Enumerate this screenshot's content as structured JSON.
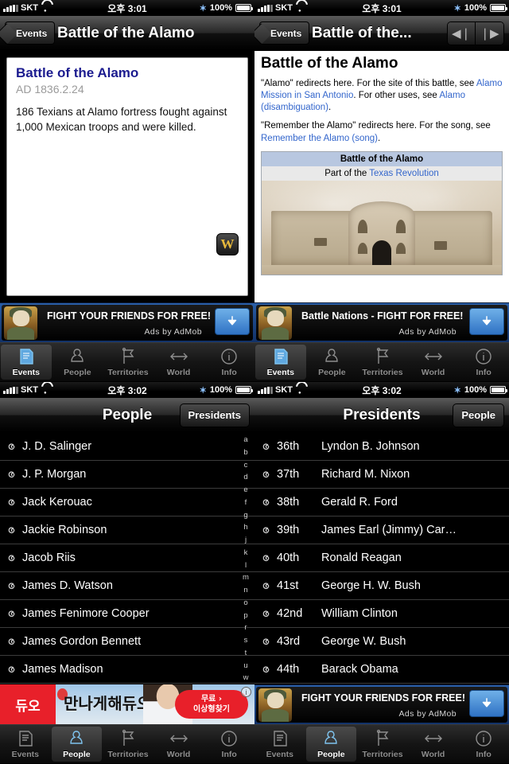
{
  "statusbar": {
    "carrier": "SKT",
    "time_top": "오후 3:01",
    "time_bottom": "오후 3:02",
    "battery": "100%",
    "wifi_icon": "wifi-icon",
    "bluetooth_icon": "bluetooth-icon",
    "signal_icon": "signal-bars-icon"
  },
  "panel_top_left": {
    "nav": {
      "back_label": "Events",
      "title": "Battle of the Alamo"
    },
    "card": {
      "title": "Battle of the Alamo",
      "date": "AD 1836.2.24",
      "body": "186 Texians at Alamo fortress fought against 1,000 Mexican troops and were killed.",
      "wiki_badge": "W"
    },
    "ad": {
      "title": "FIGHT YOUR FRIENDS FOR FREE!",
      "attribution": "Ads by AdMob",
      "download_icon": "download-arrow-icon"
    }
  },
  "panel_top_right": {
    "nav": {
      "back_label": "Events",
      "title": "Battle of the...",
      "prev_icon": "prev-arrow-icon",
      "next_icon": "next-arrow-icon"
    },
    "wiki": {
      "heading": "Battle of the Alamo",
      "para1_a": "\"Alamo\" redirects here. For the site of this battle, see ",
      "para1_link1": "Alamo Mission in San Antonio",
      "para1_b": ". For other uses, see ",
      "para1_link2": "Alamo (disambiguation)",
      "para1_c": ".",
      "para2_a": "\"Remember the Alamo\" redirects here. For the song, see ",
      "para2_link1": "Remember the Alamo (song)",
      "para2_b": ".",
      "infobox_title": "Battle of the Alamo",
      "infobox_sub_a": "Part of the ",
      "infobox_sub_link": "Texas Revolution"
    },
    "ad": {
      "title": "Battle Nations - FIGHT FOR FREE!",
      "attribution": "Ads by AdMob",
      "download_icon": "download-arrow-icon"
    }
  },
  "panel_bottom_left": {
    "nav": {
      "title": "People",
      "right_button": "Presidents"
    },
    "rows": [
      {
        "name": "J. D. Salinger"
      },
      {
        "name": "J. P. Morgan"
      },
      {
        "name": "Jack Kerouac"
      },
      {
        "name": "Jackie Robinson"
      },
      {
        "name": "Jacob Riis"
      },
      {
        "name": "James D. Watson"
      },
      {
        "name": "James Fenimore Cooper"
      },
      {
        "name": "James Gordon Bennett"
      },
      {
        "name": "James Madison"
      }
    ],
    "index_letters": [
      "a",
      "b",
      "c",
      "d",
      "e",
      "f",
      "g",
      "h",
      "j",
      "k",
      "l",
      "m",
      "n",
      "o",
      "p",
      "r",
      "s",
      "t",
      "u",
      "w"
    ],
    "ad": {
      "brand": "듀오",
      "headline": "만나게해듀오",
      "cta_line1": "무료 ›",
      "cta_line2": "이상형찾기",
      "info_icon": "ad-info-icon"
    }
  },
  "panel_bottom_right": {
    "nav": {
      "title": "Presidents",
      "right_button": "People"
    },
    "rows": [
      {
        "ordinal": "36th",
        "name": "Lyndon B. Johnson"
      },
      {
        "ordinal": "37th",
        "name": "Richard M. Nixon"
      },
      {
        "ordinal": "38th",
        "name": "Gerald R. Ford"
      },
      {
        "ordinal": "39th",
        "name": "James Earl (Jimmy) Car…"
      },
      {
        "ordinal": "40th",
        "name": "Ronald Reagan"
      },
      {
        "ordinal": "41st",
        "name": "George H. W. Bush"
      },
      {
        "ordinal": "42nd",
        "name": "William Clinton"
      },
      {
        "ordinal": "43rd",
        "name": "George W. Bush"
      },
      {
        "ordinal": "44th",
        "name": "Barack Obama"
      }
    ],
    "ad": {
      "title": "FIGHT YOUR FRIENDS FOR FREE!",
      "attribution": "Ads by AdMob",
      "download_icon": "download-arrow-icon"
    }
  },
  "tabbar": {
    "items": [
      {
        "label": "Events",
        "icon": "document-icon"
      },
      {
        "label": "People",
        "icon": "person-icon"
      },
      {
        "label": "Territories",
        "icon": "flag-icon"
      },
      {
        "label": "World",
        "icon": "arrows-icon"
      },
      {
        "label": "Info",
        "icon": "info-icon"
      }
    ]
  },
  "colors": {
    "link": "#3366cc",
    "card_title": "#1b1b8f",
    "accent_tab": "#5fa8e0",
    "infobox_header": "#b8c7e0",
    "ad_blue": "#2f72c4"
  }
}
